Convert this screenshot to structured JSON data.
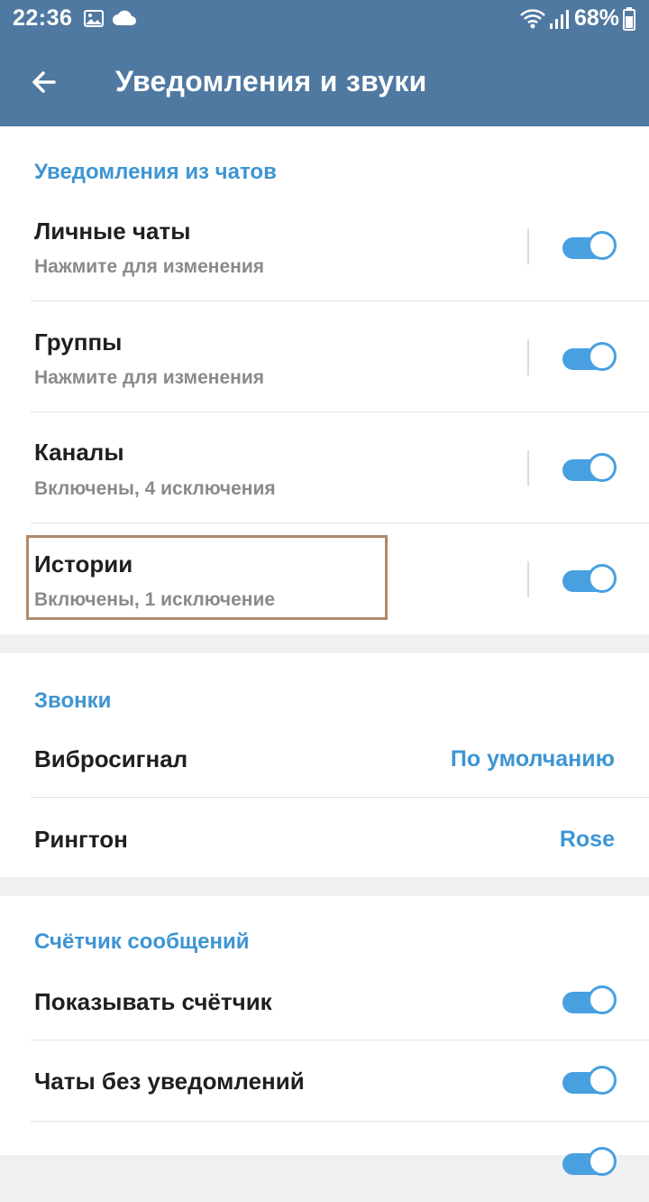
{
  "status_bar": {
    "time": "22:36",
    "battery": "68%",
    "icons": [
      "image-icon",
      "cloud-icon",
      "wifi-icon",
      "signal-icon",
      "battery-icon"
    ]
  },
  "app_bar": {
    "back_icon": "arrow-left-icon",
    "title": "Уведомления и звуки"
  },
  "chats_section": {
    "header": "Уведомления из чатов",
    "rows": [
      {
        "title": "Личные чаты",
        "subtitle": "Нажмите для изменения",
        "toggle_on": true
      },
      {
        "title": "Группы",
        "subtitle": "Нажмите для изменения",
        "toggle_on": true
      },
      {
        "title": "Каналы",
        "subtitle": "Включены, 4 исключения",
        "toggle_on": true
      },
      {
        "title": "Истории",
        "subtitle": "Включены, 1 исключение",
        "toggle_on": true
      }
    ]
  },
  "calls_section": {
    "header": "Звонки",
    "rows": [
      {
        "title": "Вибросигнал",
        "value": "По умолчанию"
      },
      {
        "title": "Рингтон",
        "value": "Rose"
      }
    ]
  },
  "counter_section": {
    "header": "Счётчик сообщений",
    "rows": [
      {
        "title": "Показывать счётчик",
        "toggle_on": true
      },
      {
        "title": "Чаты без уведомлений",
        "toggle_on": true
      },
      {
        "title": "",
        "toggle_on": true
      }
    ]
  },
  "colors": {
    "app_bar": "#5079a2",
    "accent": "#3d95d3",
    "toggle": "#48a0e1",
    "highlight_box": "#b08969"
  }
}
